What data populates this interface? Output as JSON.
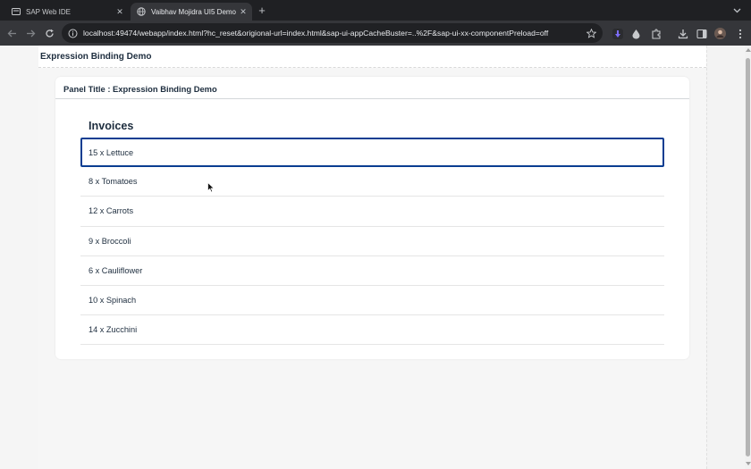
{
  "browser": {
    "tabs": [
      {
        "title": "SAP Web IDE",
        "icon": "sap-web-ide-icon",
        "active": false
      },
      {
        "title": "Vaibhav Mojidra UI5 Demo",
        "icon": "globe-icon",
        "active": true
      }
    ],
    "url": "localhost:49474/webapp/index.html?hc_reset&origional-url=index.html&sap-ui-appCacheBuster=..%2F&sap-ui-xx-componentPreload=off",
    "accent_extension_color": "#7b6cf6"
  },
  "app": {
    "title": "Expression Binding Demo"
  },
  "panel": {
    "title": "Panel Title : Expression Binding Demo"
  },
  "list": {
    "title": "Invoices",
    "items": [
      {
        "label": "15 x Lettuce"
      },
      {
        "label": "8 x Tomatoes"
      },
      {
        "label": "12 x Carrots"
      },
      {
        "label": "9 x Broccoli"
      },
      {
        "label": "6 x Cauliflower"
      },
      {
        "label": "10 x Spinach"
      },
      {
        "label": "14 x Zucchini"
      }
    ]
  },
  "colors": {
    "focus_border": "#0a3d91",
    "text": "#1d2d3e"
  }
}
